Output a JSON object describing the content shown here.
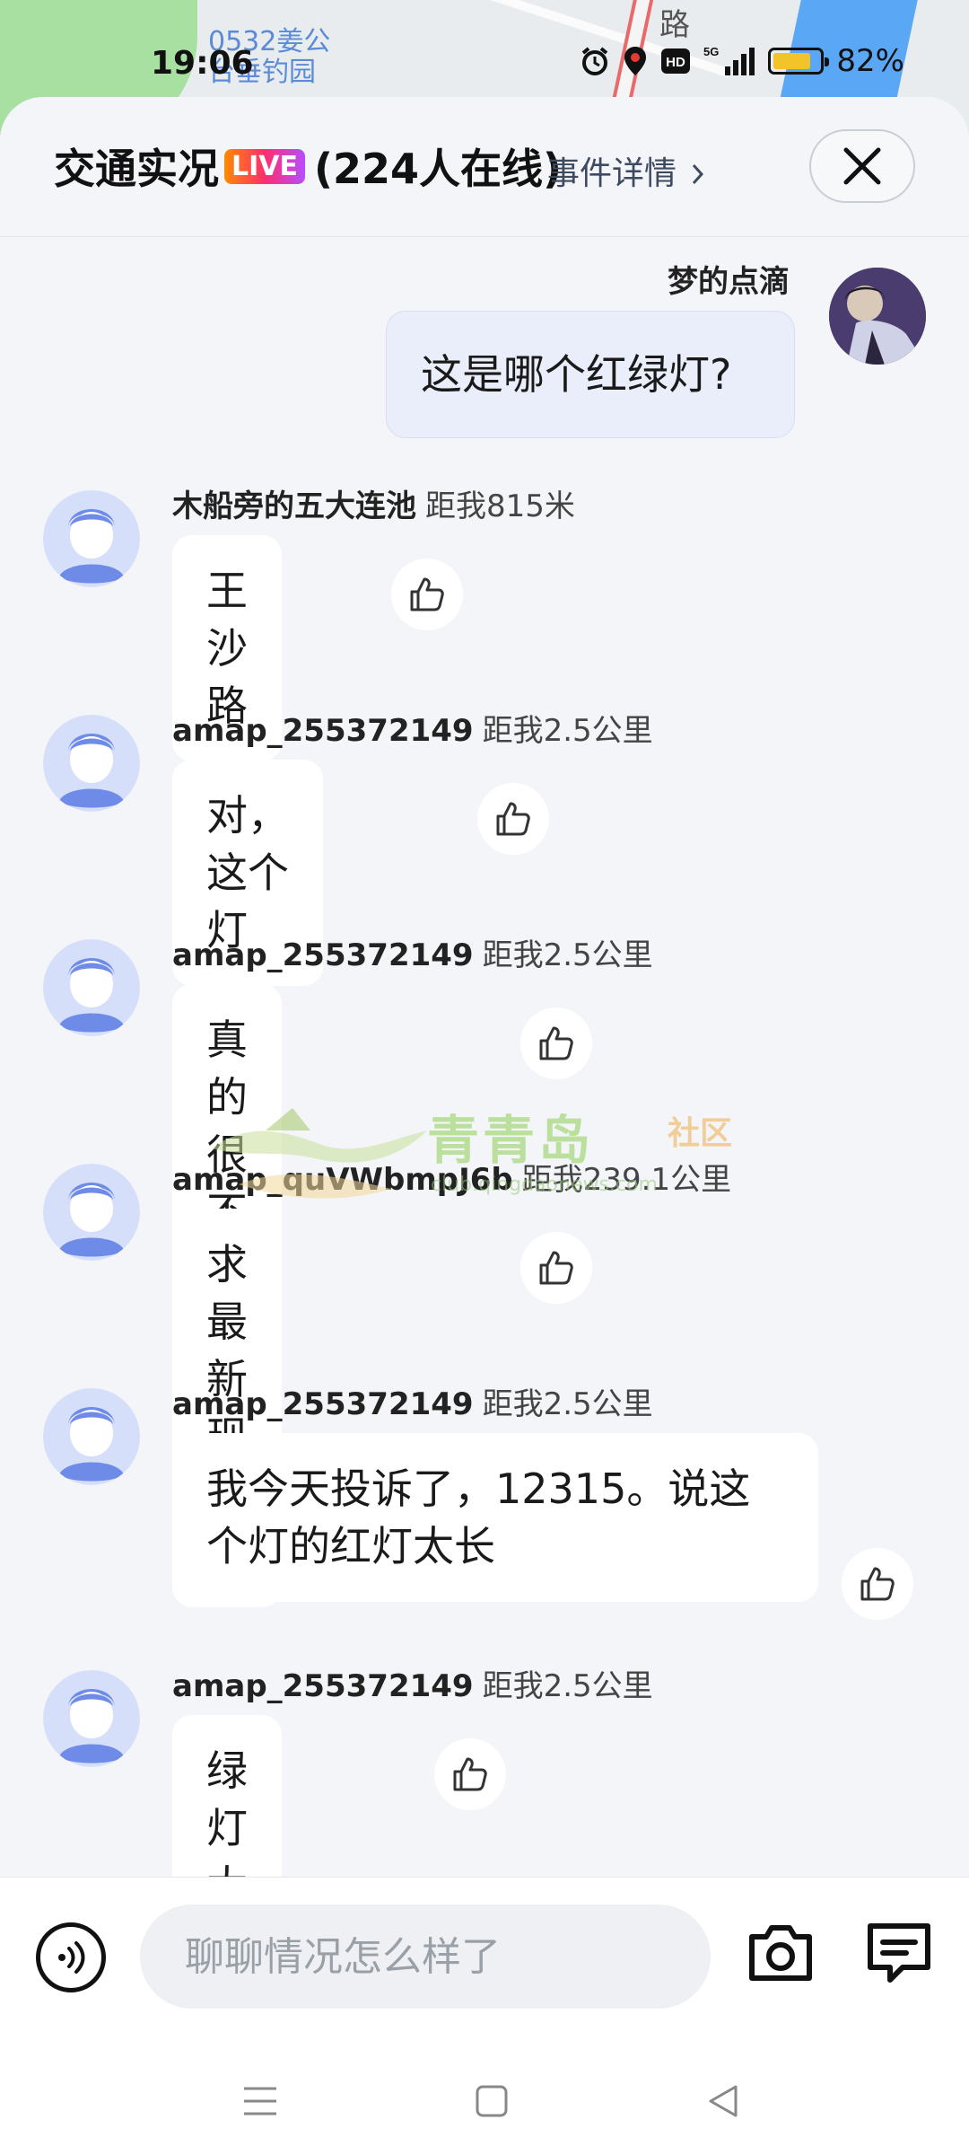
{
  "status_bar": {
    "time": "19:06",
    "battery": "82%",
    "battery_level": 0.82,
    "network": "5G",
    "hd_label": "HD",
    "icons": [
      "alarm-icon",
      "location-icon",
      "hd-icon",
      "signal-icon",
      "battery-icon"
    ]
  },
  "map": {
    "poi_line1": "0532姜公",
    "poi_line2": "台垂钓园",
    "road_label": "路"
  },
  "header": {
    "title": "交通实况",
    "live_badge": "LIVE",
    "online_count": "(224人在线)",
    "event_link": "事件详情",
    "event_link_icon": "chevron-right-icon",
    "close_icon": "close-icon"
  },
  "messages": [
    {
      "sender": "梦的点滴",
      "distance": "",
      "text": "这是哪个红绿灯?",
      "self": true
    },
    {
      "sender": "木船旁的五大连池",
      "distance": "距我815米",
      "text": "王沙路",
      "self": false
    },
    {
      "sender": "amap_255372149",
      "distance": "距我2.5公里",
      "text": "对，这个灯",
      "self": false
    },
    {
      "sender": "amap_255372149",
      "distance": "距我2.5公里",
      "text": "真的很不正常",
      "self": false
    },
    {
      "sender": "amap_quVWbmpJ6b",
      "distance": "距我239.1公里",
      "text": "求最新现场照",
      "self": false
    },
    {
      "sender": "amap_255372149",
      "distance": "距我2.5公里",
      "text_line1": "我今天投诉了，12315。说这",
      "text_line2": "个灯的红灯太长",
      "self": false
    },
    {
      "sender": "amap_255372149",
      "distance": "距我2.5公里",
      "text": "绿灯太短",
      "self": false
    }
  ],
  "watermark": {
    "name": "青青岛",
    "suffix": "社区",
    "url": "club.qingdaonews.com"
  },
  "input_bar": {
    "placeholder": "聊聊情况怎么样了",
    "icons": [
      "voice-icon",
      "camera-icon",
      "message-icon"
    ]
  },
  "nav_bar": {
    "icons": [
      "menu-icon",
      "home-icon",
      "back-icon"
    ]
  },
  "colors": {
    "background": "#f3f5f9",
    "self_bubble": "#e9eefa",
    "bubble": "#ffffff",
    "avatar_bg": "#d5dffa",
    "avatar_fg": "#6f8be8",
    "live_gradient": [
      "#ff8a00",
      "#ff2d6f",
      "#b84cff"
    ]
  }
}
